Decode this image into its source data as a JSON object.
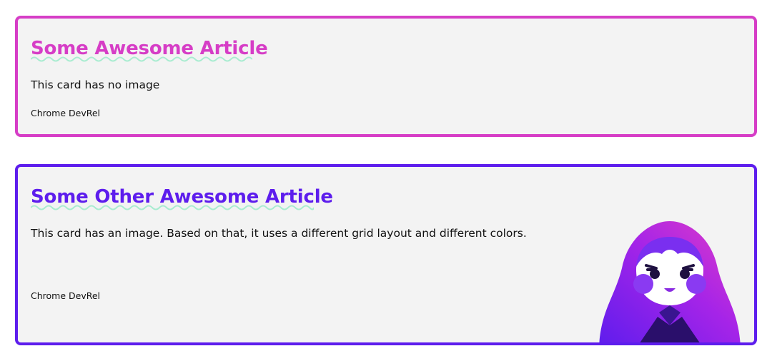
{
  "cards": [
    {
      "title": "Some Awesome Article",
      "description": "This card has no image",
      "author": "Chrome DevRel",
      "accent": "#d63dc6",
      "has_image": false
    },
    {
      "title": "Some Other Awesome Article",
      "description": "This card has an image. Based on that, it uses a different grid layout and different colors.",
      "author": "Chrome DevRel",
      "accent": "#5d1ded",
      "has_image": true,
      "image_icon": "matryoshka-doll-icon"
    }
  ],
  "colors": {
    "squiggle": "#a8ecd0",
    "card_background": "#f3f3f3"
  }
}
